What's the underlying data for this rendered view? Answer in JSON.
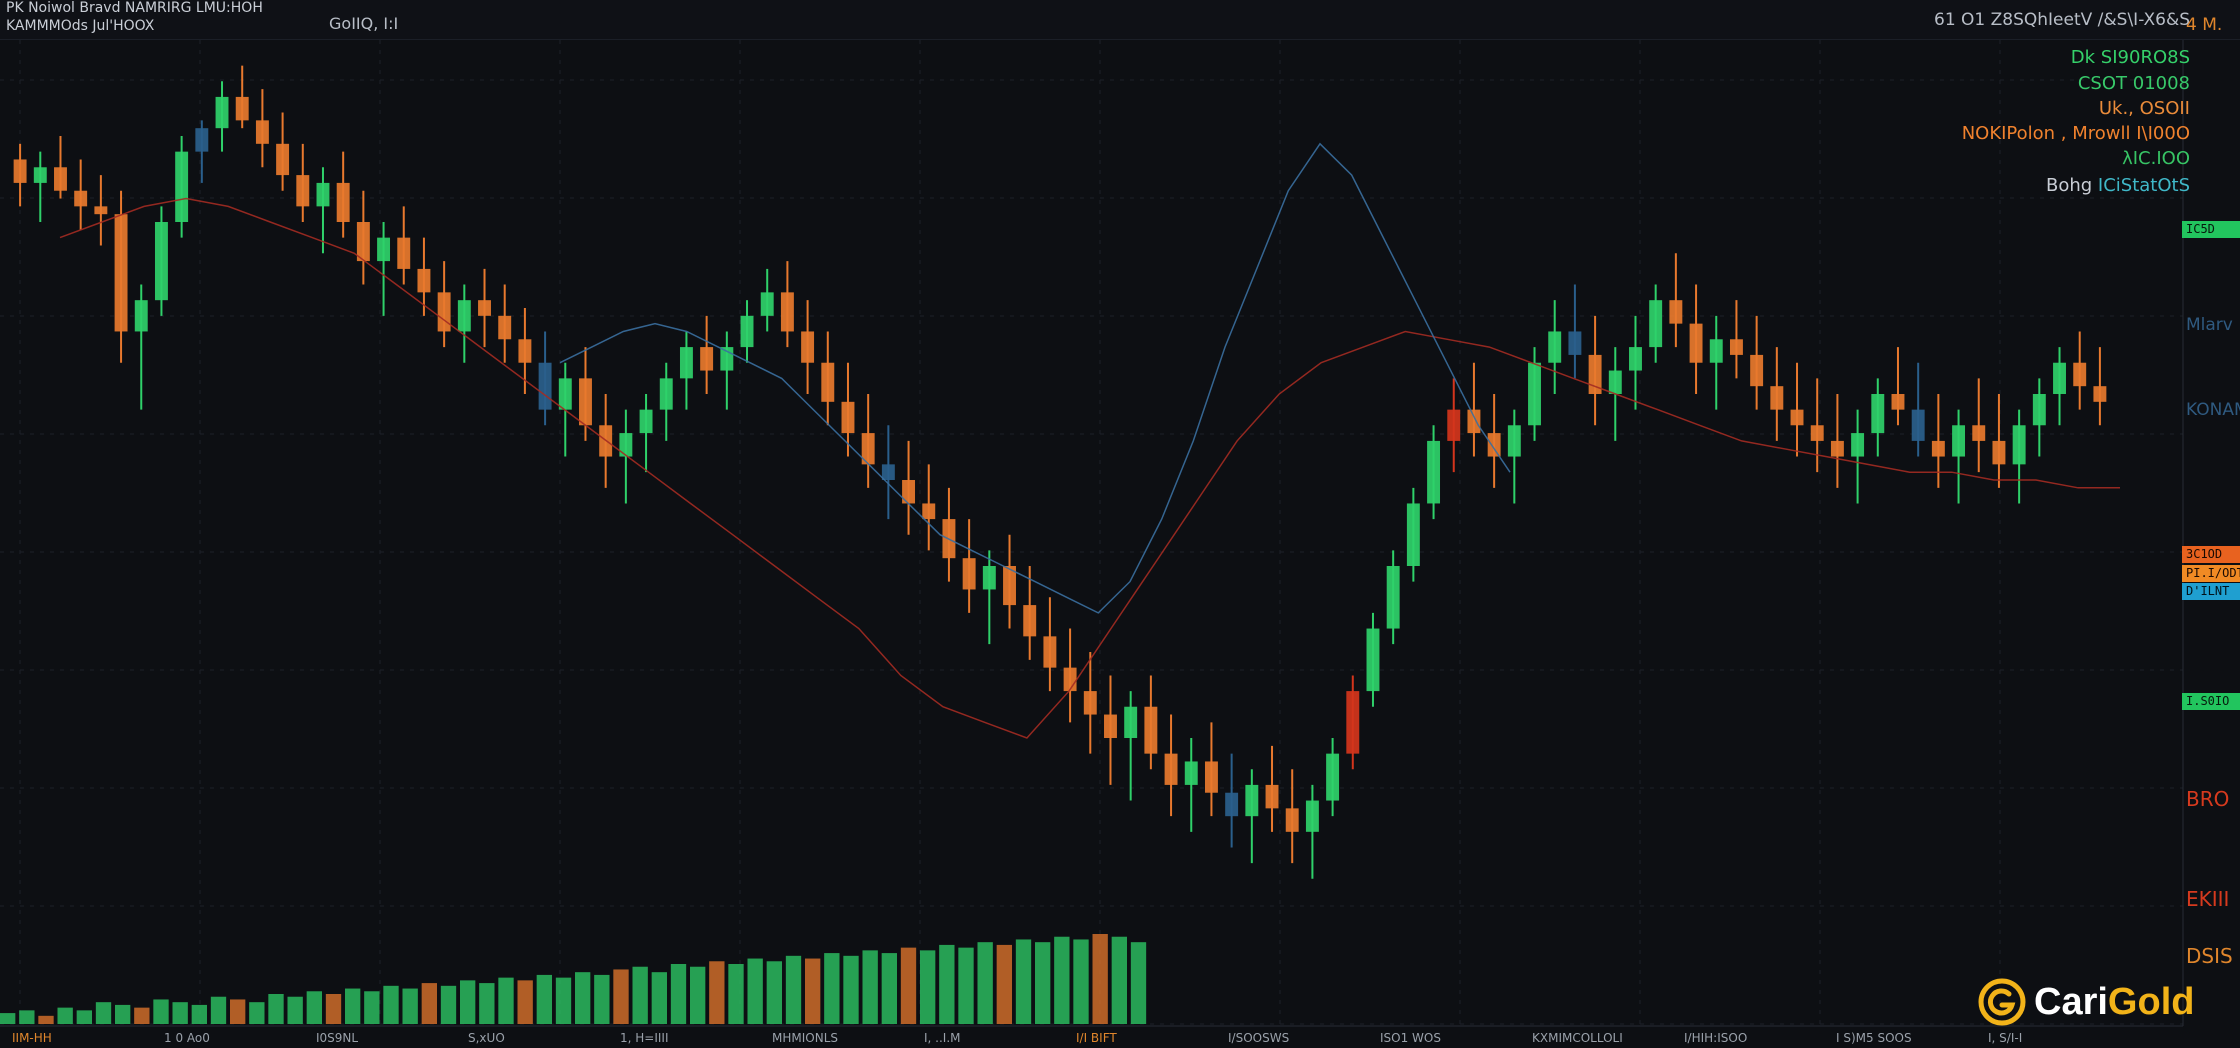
{
  "header": {
    "line1": "PK Noiwol Bravd NAMRIRG LMU:HOH",
    "line2": "KAMMMOds Jul'HOOX",
    "symbol": "GoIIQ, I:I",
    "right_info": "61 O1 Z8SQhIeetV /&S\\I-X6&S"
  },
  "legend": [
    {
      "text": "Dk SI90RO8S"
    },
    {
      "text": "CSOT 01008"
    },
    {
      "text": "Uk., OSOII"
    },
    {
      "text": "NOKIPolon , Mrowll I\\I00O"
    },
    {
      "text": "λIC.IOO"
    },
    {
      "prefix": "Bohg ",
      "text": "ICiStatOtS"
    }
  ],
  "right_axis_labels": [
    {
      "text": "4 M.",
      "color": "#e0862c"
    },
    {
      "text": "Mlarv",
      "color": "#2f5a80"
    },
    {
      "text": "KONAM",
      "color": "#2f5a80"
    }
  ],
  "price_tags": [
    {
      "text": "IC5D",
      "bg": "#22c55e",
      "fg": "#071a0d"
    },
    {
      "text": "3C1OD",
      "bg": "#e8621f",
      "fg": "#1a0a02"
    },
    {
      "text": "PI.I/ODT",
      "bg": "#f08a24",
      "fg": "#1a0a02"
    },
    {
      "text": "D'ILNT",
      "bg": "#1f9fd0",
      "fg": "#02121a"
    },
    {
      "text": "I.S0IO",
      "bg": "#22c55e",
      "fg": "#071a0d"
    }
  ],
  "right_low_labels": [
    {
      "text": "BRO",
      "color": "#d63a1e"
    },
    {
      "text": "EKIII",
      "color": "#d63a1e"
    },
    {
      "text": "DSIS",
      "color": "#e0862c"
    }
  ],
  "x_axis_labels": [
    {
      "text": "ΙΙΜ-ΗΗ",
      "color": "#e0862c"
    },
    {
      "text": "1 0 Ao0",
      "color": "#9aa1aa"
    },
    {
      "text": "I0S9NL",
      "color": "#9aa1aa"
    },
    {
      "text": "S,xUO",
      "color": "#9aa1aa"
    },
    {
      "text": "1, H=IIII",
      "color": "#9aa1aa"
    },
    {
      "text": "MHMIONLS",
      "color": "#9aa1aa"
    },
    {
      "text": "I, ..I.M",
      "color": "#9aa1aa"
    },
    {
      "text": "I/I BIFT",
      "color": "#e0862c"
    },
    {
      "text": "I/SOOSWS",
      "color": "#9aa1aa"
    },
    {
      "text": "ISO1 WOS",
      "color": "#9aa1aa"
    },
    {
      "text": "KXMIMCOLLOLI",
      "color": "#9aa1aa"
    },
    {
      "text": "I/HIH:ISOO",
      "color": "#9aa1aa"
    },
    {
      "text": "I S)M5 SOOS",
      "color": "#9aa1aa"
    },
    {
      "text": "I, S/I-I",
      "color": "#9aa1aa"
    }
  ],
  "logo": {
    "part1": "Cari",
    "part2": "Gold"
  },
  "colors": {
    "background": "#0d0f13",
    "grid": "#1d2129",
    "bull": "#2fd16a",
    "bear": "#e8792e",
    "bear_strong": "#d4351c",
    "blue": "#2a5f8c",
    "ma_red": "#a32b22",
    "ma_blue": "#3a6fa0"
  },
  "chart_data": {
    "type": "candlestick",
    "series": [
      {
        "kind": "candles",
        "values": [
          [
            96,
            98,
            90,
            93
          ],
          [
            93,
            97,
            88,
            95
          ],
          [
            95,
            99,
            91,
            92
          ],
          [
            92,
            96,
            87,
            90
          ],
          [
            90,
            94,
            85,
            89
          ],
          [
            89,
            92,
            70,
            74
          ],
          [
            74,
            80,
            64,
            78
          ],
          [
            78,
            90,
            76,
            88
          ],
          [
            88,
            99,
            86,
            97
          ],
          [
            97,
            101,
            93,
            100
          ],
          [
            100,
            106,
            97,
            104
          ],
          [
            104,
            108,
            100,
            101
          ],
          [
            101,
            105,
            95,
            98
          ],
          [
            98,
            102,
            92,
            94
          ],
          [
            94,
            98,
            88,
            90
          ],
          [
            90,
            95,
            84,
            93
          ],
          [
            93,
            97,
            86,
            88
          ],
          [
            88,
            92,
            80,
            83
          ],
          [
            83,
            88,
            76,
            86
          ],
          [
            86,
            90,
            80,
            82
          ],
          [
            82,
            86,
            76,
            79
          ],
          [
            79,
            83,
            72,
            74
          ],
          [
            74,
            80,
            70,
            78
          ],
          [
            78,
            82,
            72,
            76
          ],
          [
            76,
            80,
            70,
            73
          ],
          [
            73,
            77,
            66,
            70
          ],
          [
            70,
            74,
            62,
            64
          ],
          [
            64,
            70,
            58,
            68
          ],
          [
            68,
            72,
            60,
            62
          ],
          [
            62,
            66,
            54,
            58
          ],
          [
            58,
            64,
            52,
            61
          ],
          [
            61,
            66,
            56,
            64
          ],
          [
            64,
            70,
            60,
            68
          ],
          [
            68,
            74,
            64,
            72
          ],
          [
            72,
            76,
            66,
            69
          ],
          [
            69,
            74,
            64,
            72
          ],
          [
            72,
            78,
            70,
            76
          ],
          [
            76,
            82,
            74,
            79
          ],
          [
            79,
            83,
            72,
            74
          ],
          [
            74,
            78,
            66,
            70
          ],
          [
            70,
            74,
            62,
            65
          ],
          [
            65,
            70,
            58,
            61
          ],
          [
            61,
            66,
            54,
            57
          ],
          [
            57,
            62,
            50,
            55
          ],
          [
            55,
            60,
            48,
            52
          ],
          [
            52,
            57,
            46,
            50
          ],
          [
            50,
            54,
            42,
            45
          ],
          [
            45,
            50,
            38,
            41
          ],
          [
            41,
            46,
            34,
            44
          ],
          [
            44,
            48,
            36,
            39
          ],
          [
            39,
            44,
            32,
            35
          ],
          [
            35,
            40,
            28,
            31
          ],
          [
            31,
            36,
            24,
            28
          ],
          [
            28,
            33,
            20,
            25
          ],
          [
            25,
            30,
            16,
            22
          ],
          [
            22,
            28,
            14,
            26
          ],
          [
            26,
            30,
            18,
            20
          ],
          [
            20,
            25,
            12,
            16
          ],
          [
            16,
            22,
            10,
            19
          ],
          [
            19,
            24,
            12,
            15
          ],
          [
            15,
            20,
            8,
            12
          ],
          [
            12,
            18,
            6,
            16
          ],
          [
            16,
            21,
            10,
            13
          ],
          [
            13,
            18,
            6,
            10
          ],
          [
            10,
            16,
            4,
            14
          ],
          [
            14,
            22,
            12,
            20
          ],
          [
            20,
            30,
            18,
            28
          ],
          [
            28,
            38,
            26,
            36
          ],
          [
            36,
            46,
            34,
            44
          ],
          [
            44,
            54,
            42,
            52
          ],
          [
            52,
            62,
            50,
            60
          ],
          [
            60,
            68,
            56,
            64
          ],
          [
            64,
            70,
            58,
            61
          ],
          [
            61,
            66,
            54,
            58
          ],
          [
            58,
            64,
            52,
            62
          ],
          [
            62,
            72,
            60,
            70
          ],
          [
            70,
            78,
            66,
            74
          ],
          [
            74,
            80,
            68,
            71
          ],
          [
            71,
            76,
            62,
            66
          ],
          [
            66,
            72,
            60,
            69
          ],
          [
            69,
            76,
            64,
            72
          ],
          [
            72,
            80,
            70,
            78
          ],
          [
            78,
            84,
            72,
            75
          ],
          [
            75,
            80,
            66,
            70
          ],
          [
            70,
            76,
            64,
            73
          ],
          [
            73,
            78,
            68,
            71
          ],
          [
            71,
            76,
            64,
            67
          ],
          [
            67,
            72,
            60,
            64
          ],
          [
            64,
            70,
            58,
            62
          ],
          [
            62,
            68,
            56,
            60
          ],
          [
            60,
            66,
            54,
            58
          ],
          [
            58,
            64,
            52,
            61
          ],
          [
            61,
            68,
            58,
            66
          ],
          [
            66,
            72,
            62,
            64
          ],
          [
            64,
            70,
            58,
            60
          ],
          [
            60,
            66,
            54,
            58
          ],
          [
            58,
            64,
            52,
            62
          ],
          [
            62,
            68,
            56,
            60
          ],
          [
            60,
            66,
            54,
            57
          ],
          [
            57,
            64,
            52,
            62
          ],
          [
            62,
            68,
            58,
            66
          ],
          [
            66,
            72,
            62,
            70
          ],
          [
            70,
            74,
            64,
            67
          ],
          [
            67,
            72,
            62,
            65
          ]
        ]
      },
      {
        "kind": "volume",
        "values": [
          4,
          5,
          3,
          6,
          5,
          8,
          7,
          6,
          9,
          8,
          7,
          10,
          9,
          8,
          11,
          10,
          12,
          11,
          13,
          12,
          14,
          13,
          15,
          14,
          16,
          15,
          17,
          16,
          18,
          17,
          19,
          18,
          20,
          21,
          19,
          22,
          21,
          23,
          22,
          24,
          23,
          25,
          24,
          26,
          25,
          27,
          26,
          28,
          27,
          29,
          28,
          30,
          29,
          31,
          30,
          32,
          31,
          33,
          32,
          30
        ]
      },
      {
        "kind": "line",
        "name": "",
        "color": "red",
        "values": [
          86,
          88,
          90,
          91,
          90,
          88,
          86,
          84,
          80,
          76,
          72,
          68,
          64,
          60,
          56,
          52,
          48,
          44,
          40,
          36,
          30,
          26,
          24,
          22,
          28,
          36,
          44,
          52,
          60,
          66,
          70,
          72,
          74,
          73,
          72,
          70,
          68,
          66,
          64,
          62,
          60,
          59,
          58,
          57,
          56,
          56,
          55,
          55,
          54,
          54
        ]
      },
      {
        "kind": "line",
        "name": "",
        "color": "blue",
        "values": [
          70,
          72,
          74,
          75,
          74,
          72,
          70,
          68,
          64,
          60,
          56,
          52,
          48,
          46,
          44,
          42,
          40,
          38,
          42,
          50,
          60,
          72,
          82,
          92,
          98,
          94,
          86,
          78,
          70,
          62,
          56
        ]
      }
    ],
    "ylim": [
      0,
      110
    ],
    "grid": true
  }
}
